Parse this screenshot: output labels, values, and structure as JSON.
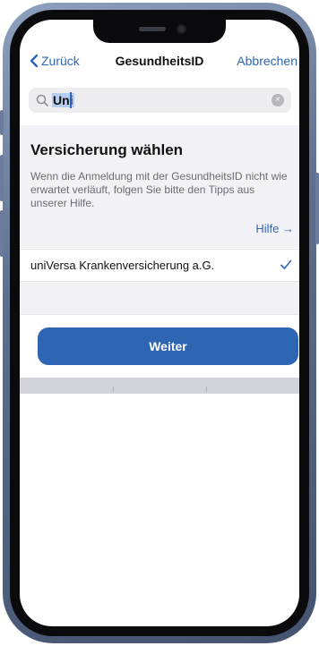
{
  "nav": {
    "back_label": "Zurück",
    "title": "GesundheitsID",
    "cancel_label": "Abbrechen"
  },
  "search": {
    "value": "Uni",
    "search_icon": "search-icon",
    "clear_icon": "clear-icon"
  },
  "section": {
    "title": "Versicherung wählen",
    "text": "Wenn die Anmeldung mit der GesundheitsID nicht wie erwartet verläuft, folgen Sie bitte den Tipps aus unserer Hilfe.",
    "help_label": "Hilfe →"
  },
  "list": {
    "items": [
      {
        "label": "uniVersa Krankenversicherung a.G.",
        "selected": true
      }
    ]
  },
  "primary_button": {
    "label": "Weiter"
  },
  "colors": {
    "accent": "#2f66b3",
    "section_bg": "#f2f2f6",
    "search_bg": "#ededf0"
  }
}
